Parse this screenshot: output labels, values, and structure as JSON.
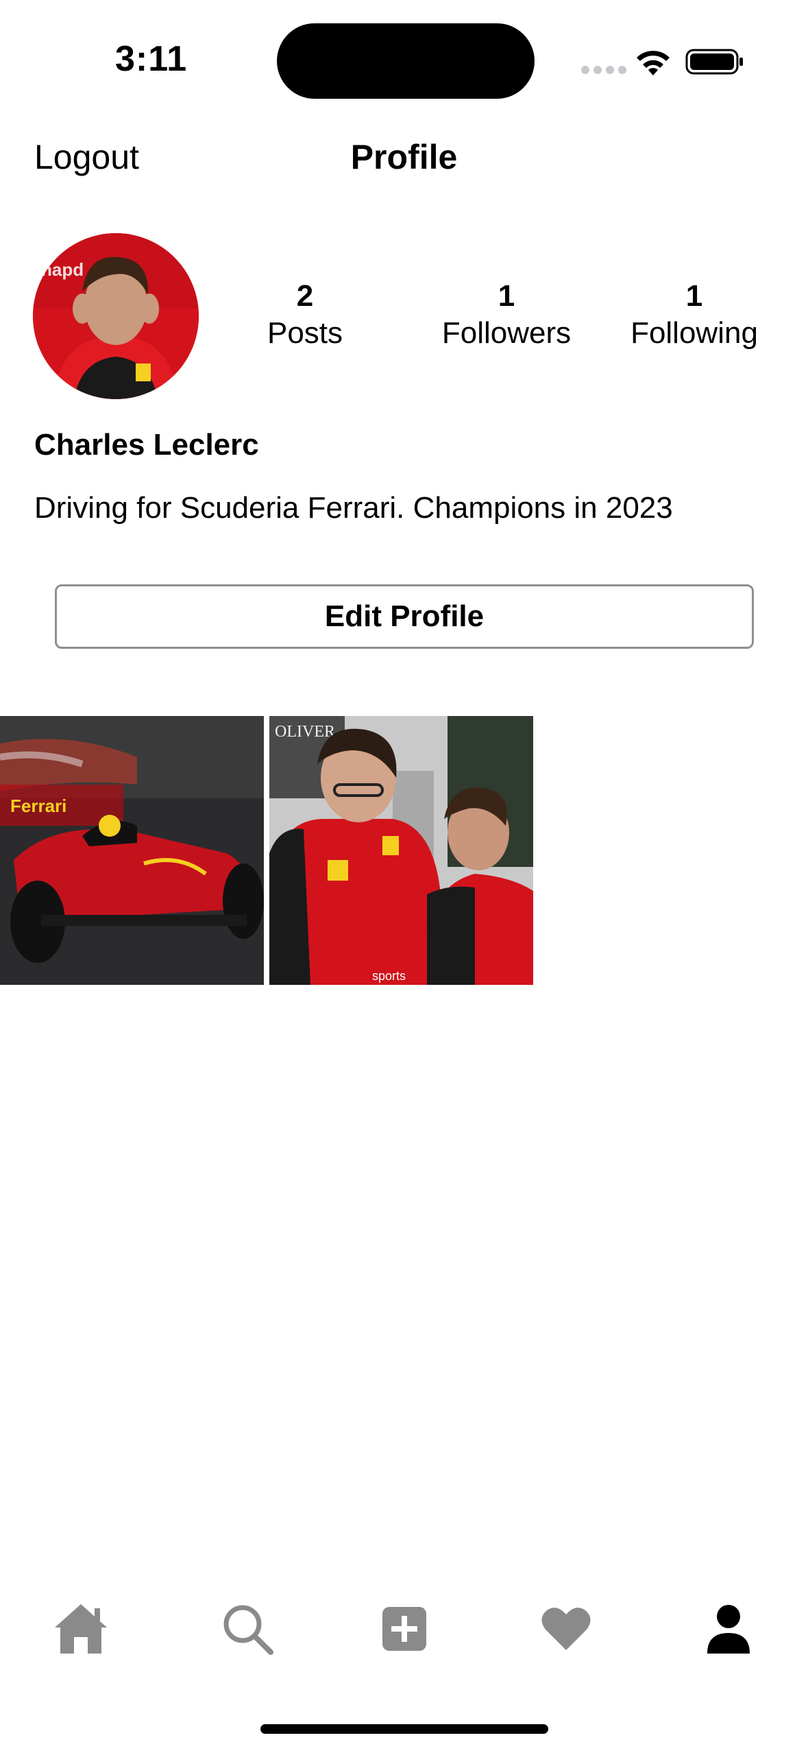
{
  "status_bar": {
    "time": "3:11"
  },
  "nav": {
    "logout_label": "Logout",
    "title": "Profile"
  },
  "profile": {
    "name": "Charles Leclerc",
    "bio": "Driving for Scuderia Ferrari. Champions in 2023",
    "stats": [
      {
        "value": "2",
        "label": "Posts"
      },
      {
        "value": "1",
        "label": "Followers"
      },
      {
        "value": "1",
        "label": "Following"
      }
    ],
    "edit_label": "Edit Profile"
  },
  "posts": [
    {
      "description": "Ferrari F1 car on track"
    },
    {
      "description": "Team principal talking with driver"
    }
  ],
  "tabbar": {
    "items": [
      {
        "icon": "home-icon"
      },
      {
        "icon": "search-icon"
      },
      {
        "icon": "add-post-icon"
      },
      {
        "icon": "heart-icon"
      },
      {
        "icon": "profile-icon",
        "active": true
      }
    ]
  },
  "colors": {
    "inactive_tab": "#8a8a8a",
    "active_tab": "#000000",
    "ferrari_red": "#d3131b"
  }
}
